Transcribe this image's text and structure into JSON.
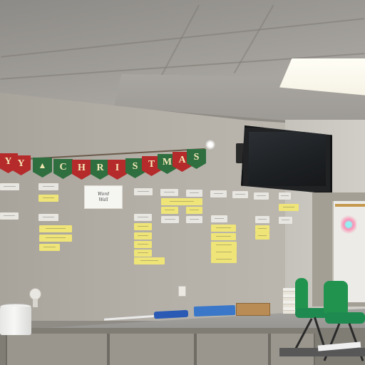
{
  "scene": {
    "banner": {
      "letters": [
        "Y",
        "",
        "C",
        "H",
        "R",
        "I",
        "S",
        "T",
        "M",
        "A",
        "S"
      ],
      "colors": [
        "red",
        "green",
        "red",
        "green",
        "red",
        "green",
        "red",
        "green",
        "red",
        "green",
        "red"
      ]
    },
    "note_card": {
      "line1": "Word",
      "line2": "Wall"
    },
    "colors": {
      "wall": "#b3afa7",
      "banner_red": "#b52a2a",
      "banner_green": "#2f6f3f",
      "sticky_yellow": "#efe477",
      "chair_green": "#1f8a4f",
      "tv_black": "#202224",
      "blue_items": "#3a77c8"
    }
  }
}
